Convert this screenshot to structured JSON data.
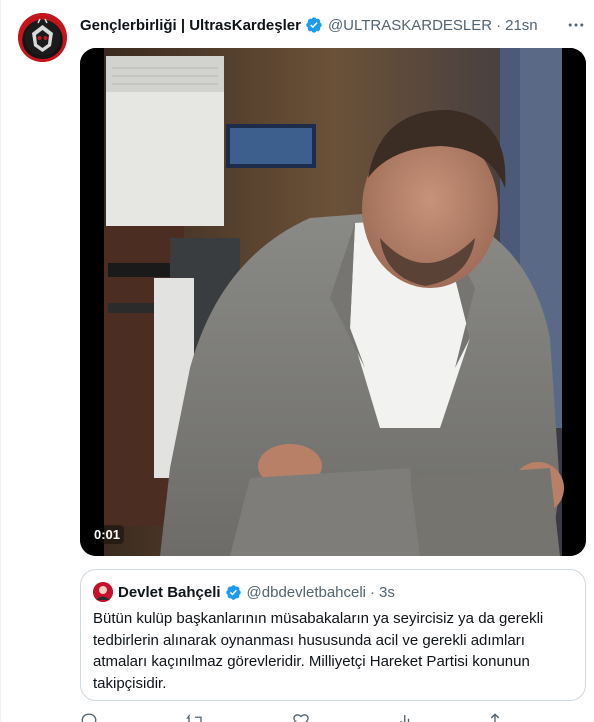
{
  "tweet": {
    "display_name": "Gençlerbirliği | UltrasKardeşler",
    "handle": "@ULTRASKARDESLER",
    "separator": "·",
    "time": "21sn",
    "avatar_icon": "club-crest-avatar",
    "verified_icon": "verified-badge-icon",
    "more_icon": "more-options-icon"
  },
  "media": {
    "type": "video",
    "timestamp": "0:01"
  },
  "quote": {
    "display_name": "Devlet Bahçeli",
    "handle": "@dbdevletbahceli",
    "separator": "·",
    "time": "3s",
    "text": "Bütün kulüp başkanlarının müsabakaların ya seyircisiz ya da gerekli tedbirlerin alınarak oynanması hususunda acil ve gerekli adımları atmaları kaçınılmaz görevleridir. Milliyetçi Hareket Partisi konunun takipçisidir."
  },
  "actions": [
    {
      "icon": "reply-icon"
    },
    {
      "icon": "retweet-icon"
    },
    {
      "icon": "like-icon"
    },
    {
      "icon": "views-icon"
    },
    {
      "icon": "share-icon"
    }
  ],
  "colors": {
    "accent": "#1d9bf0",
    "text": "#0f1419",
    "secondary": "#536471",
    "border": "#cfd9de"
  }
}
